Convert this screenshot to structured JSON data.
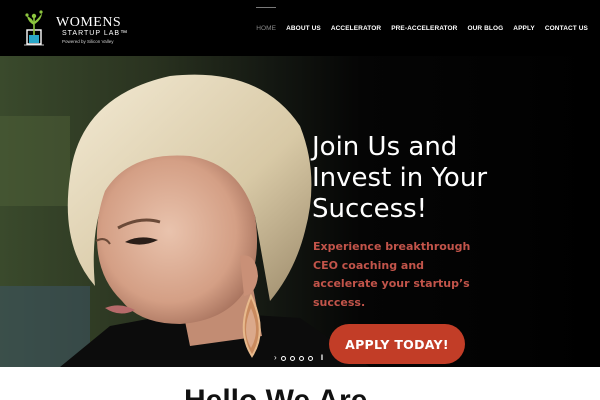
{
  "brand": {
    "name": "WOMENS",
    "sub": "STARTUP LAB™",
    "tagline": "Powered by Silicon Valley",
    "accent": "#8dc63f"
  },
  "nav": {
    "items": [
      {
        "label": "HOME",
        "active": true
      },
      {
        "label": "ABOUT US",
        "active": false
      },
      {
        "label": "ACCELERATOR",
        "active": false
      },
      {
        "label": "PRE-ACCELERATOR",
        "active": false
      },
      {
        "label": "OUR BLOG",
        "active": false
      },
      {
        "label": "APPLY",
        "active": false
      },
      {
        "label": "CONTACT US",
        "active": false
      }
    ]
  },
  "hero": {
    "headline": "Join Us and Invest in Your Success!",
    "subtext": "Experience breakthrough CEO coaching and accelerate your startup’s success.",
    "cta_label": "APPLY TODAY!",
    "cta_color": "#c23d27",
    "slider": {
      "slide_count": 4,
      "prev_icon": "chevron-right-icon",
      "pause_icon": "pause-icon"
    }
  },
  "section": {
    "title": "Hello We Are"
  }
}
